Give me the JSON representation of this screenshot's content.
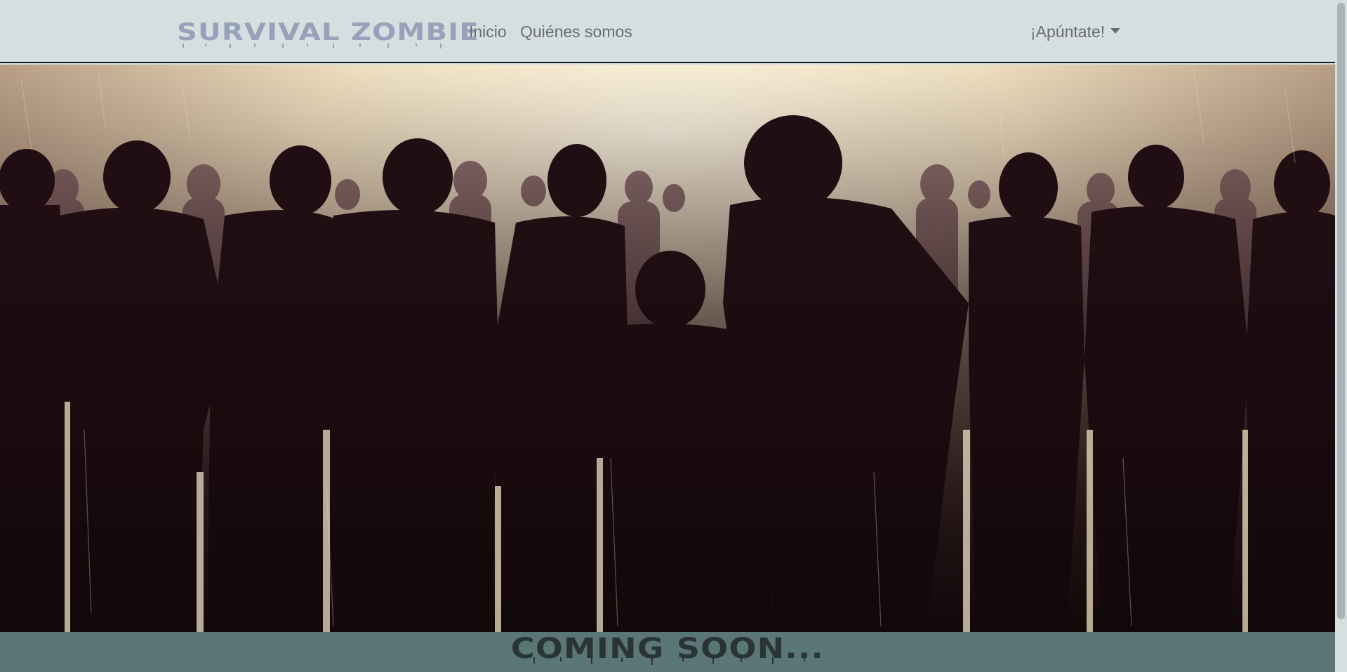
{
  "navbar": {
    "brand": "SURVIVAL ZOMBIE",
    "links": [
      {
        "label": "Inicio"
      },
      {
        "label": "Quiénes somos"
      }
    ],
    "dropdown": {
      "label": "¡Apúntate!",
      "icon": "caret-down-icon"
    }
  },
  "hero": {
    "image": "zombie-horde-silhouettes"
  },
  "footer": {
    "text": "COMING SOON..."
  },
  "colors": {
    "navbar_bg": "#d5dfe0",
    "brand": "#97a2ba",
    "link": "#6c6c6c",
    "footer_bg": "#5b7676",
    "footer_text": "#2b3434"
  }
}
